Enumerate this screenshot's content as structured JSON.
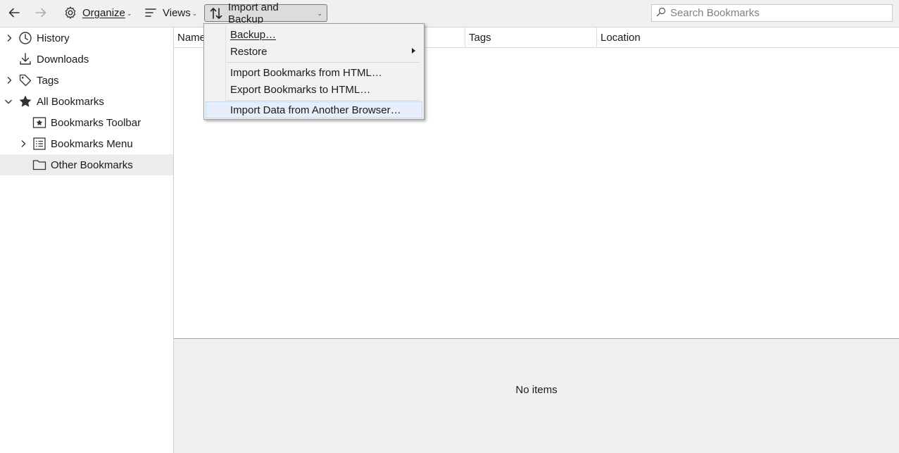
{
  "toolbar": {
    "back_icon": "arrow-left-icon",
    "forward_icon": "arrow-right-icon",
    "organize_label": "Organize",
    "views_label": "Views",
    "import_label": "Import and Backup",
    "search_placeholder": "Search Bookmarks"
  },
  "sidebar": {
    "items": [
      {
        "label": "History",
        "icon": "clock-icon",
        "expandable": true
      },
      {
        "label": "Downloads",
        "icon": "download-icon",
        "expandable": false
      },
      {
        "label": "Tags",
        "icon": "tag-icon",
        "expandable": true
      },
      {
        "label": "All Bookmarks",
        "icon": "star-icon",
        "expanded": true
      },
      {
        "label": "Bookmarks Toolbar",
        "icon": "toolbar-star-icon",
        "expandable": false
      },
      {
        "label": "Bookmarks Menu",
        "icon": "menu-list-icon",
        "expandable": true
      },
      {
        "label": "Other Bookmarks",
        "icon": "folder-icon",
        "selected": true
      }
    ]
  },
  "table": {
    "columns": [
      "Name",
      "Tags",
      "Location"
    ]
  },
  "details": {
    "empty_text": "No items"
  },
  "import_menu": {
    "items": [
      {
        "label": "Backup…"
      },
      {
        "label": "Restore",
        "submenu": true
      },
      {
        "label": "Import Bookmarks from HTML…"
      },
      {
        "label": "Export Bookmarks to HTML…"
      },
      {
        "label": "Import Data from Another Browser…",
        "highlighted": true
      }
    ]
  },
  "colors": {
    "toolbar_bg": "#f0f0f0",
    "selected_row": "#ececec",
    "menu_highlight": "#e5eefa"
  }
}
